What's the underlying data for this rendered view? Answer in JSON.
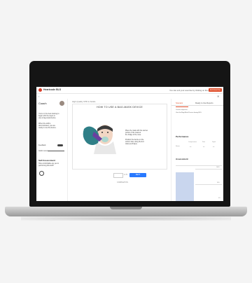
{
  "topbar": {
    "app_name": "Heartcode BLS",
    "promo_text": "You can exit your exercise by clicking on the exit icon",
    "promo_button": "Exit Exercise"
  },
  "nav": {
    "back_glyph": "‹",
    "close_glyph": "✕"
  },
  "coach": {
    "title": "Coach",
    "lines": [
      "You're in the best training to",
      "begin with the steps to",
      "use a bag-mask device.",
      "When the skill is",
      "demonstrated, you are",
      "ready to use the device."
    ],
    "toggle_label": "Feedback",
    "feedback_label": "Audio Level"
  },
  "self_assessment": {
    "title": "Self Assessment",
    "lines": [
      "How comfortable are you in",
      "performing this skill?"
    ]
  },
  "center": {
    "breadcrumb": "High-Quality CPR in Adults",
    "heading": "HOW TO USE A BAG-MASK DEVICE",
    "desc": [
      "Place the mask with the narrow",
      "portion of the mask at",
      "the bridge of the nose.",
      "Position the device on the",
      "victim's face using the E-C",
      "clamp technique."
    ],
    "page_indicator": "1 / 5",
    "next_label": "NEXT",
    "progress_label": "COMPLETION"
  },
  "right": {
    "tab1": "Scenario",
    "tab2": "Ready to Use Reports",
    "lines": [
      "Current objective:",
      "Use the Bag-Mask Device during BLS"
    ],
    "performance": {
      "title": "Performance",
      "columns": [
        "Compressions",
        "Rate",
        "Depth"
      ],
      "row_label": "Score",
      "values": [
        "--",
        "--",
        "--"
      ]
    },
    "assessment_title": "Assessment",
    "chart": {
      "y_labels": [
        "100%",
        "50%",
        "0%"
      ]
    }
  },
  "colors": {
    "accent": "#e04f2c",
    "primary": "#2979ff"
  }
}
